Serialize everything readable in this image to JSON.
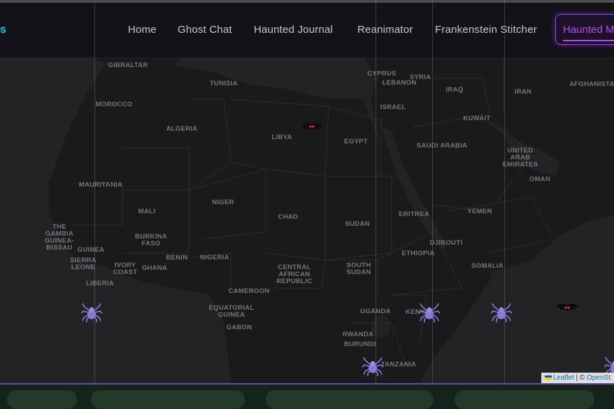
{
  "nav": {
    "brand_fragment": "s",
    "links": [
      "Home",
      "Ghost Chat",
      "Haunted Journal",
      "Reanimator",
      "Frankenstein Stitcher"
    ],
    "active_link": "Haunted M"
  },
  "map": {
    "country_labels": [
      "GIBRALTAR",
      "TUNISIA",
      "MOROCCO",
      "ALGERIA",
      "LIBYA",
      "EGYPT",
      "CYPRUS",
      "LEBANON",
      "SYRIA",
      "ISRAEL",
      "IRAQ",
      "IRAN",
      "AFGHANISTAN",
      "KUWAIT",
      "SAUDI ARABIA",
      "UNITED\nARAB\nEMIRATES",
      "OMAN",
      "YEMEN",
      "MAURITANIA",
      "MALI",
      "NIGER",
      "CHAD",
      "SUDAN",
      "ERITREA",
      "DJIBOUTI",
      "ETHIOPIA",
      "SOMALIA",
      "THE\nGAMBIA\nGUINEA-\nBISSAU",
      "GUINEA",
      "SIERRA\nLEONE",
      "LIBERIA",
      "BURKINA\nFASO",
      "IVORY\nCOAST",
      "GHANA",
      "BENIN",
      "NIGERIA",
      "CENTRAL\nAFRICAN\nREPUBLIC",
      "SOUTH\nSUDAN",
      "CAMEROON",
      "EQUATORIAL\nGUINEA",
      "GABON",
      "UGANDA",
      "KENYA",
      "RWANDA",
      "BURUNDI",
      "TANZANIA"
    ],
    "markers": [
      {
        "type": "bat",
        "icon": "bat-icon"
      },
      {
        "type": "spider",
        "icon": "spider-icon"
      },
      {
        "type": "spider",
        "icon": "spider-icon"
      },
      {
        "type": "spider",
        "icon": "spider-icon"
      },
      {
        "type": "bat",
        "icon": "bat-icon"
      },
      {
        "type": "spider",
        "icon": "spider-icon"
      },
      {
        "type": "spider",
        "icon": "spider-icon"
      }
    ],
    "attribution": {
      "leaflet": "Leaflet",
      "separator": " | © ",
      "osm": "OpenSt"
    }
  },
  "colors": {
    "accent": "#b249f5",
    "brand": "#1ec8e8",
    "map_land": "#1a1a1c",
    "map_water": "#232326",
    "spider": "#8a7ad8",
    "bat_eyes": "#ff2a2a"
  }
}
